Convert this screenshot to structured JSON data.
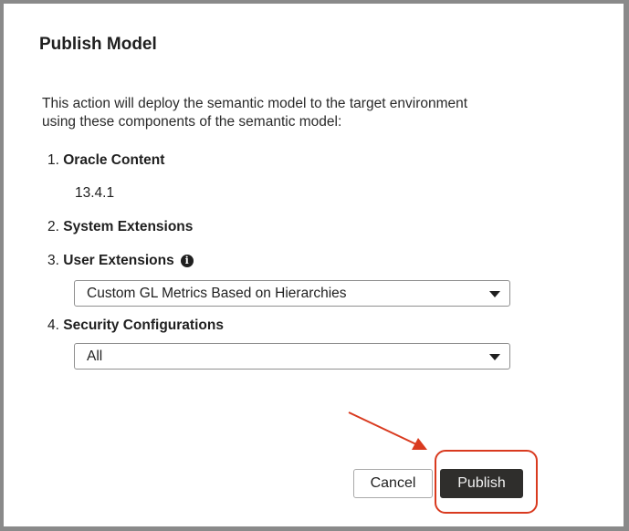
{
  "dialog": {
    "title": "Publish Model",
    "description_line1": "This action will deploy the semantic model to the target environment",
    "description_line2": "using these components of the semantic model:",
    "components": [
      {
        "number": "1.",
        "label": "Oracle Content",
        "value": "13.4.1"
      },
      {
        "number": "2.",
        "label": "System Extensions"
      },
      {
        "number": "3.",
        "label": "User Extensions",
        "info_icon": "i",
        "selected": "Custom GL Metrics Based on Hierarchies"
      },
      {
        "number": "4.",
        "label": "Security Configurations",
        "selected": "All"
      }
    ],
    "cancel_label": "Cancel",
    "publish_label": "Publish"
  },
  "annotation": {
    "color": "#d93a1f"
  }
}
